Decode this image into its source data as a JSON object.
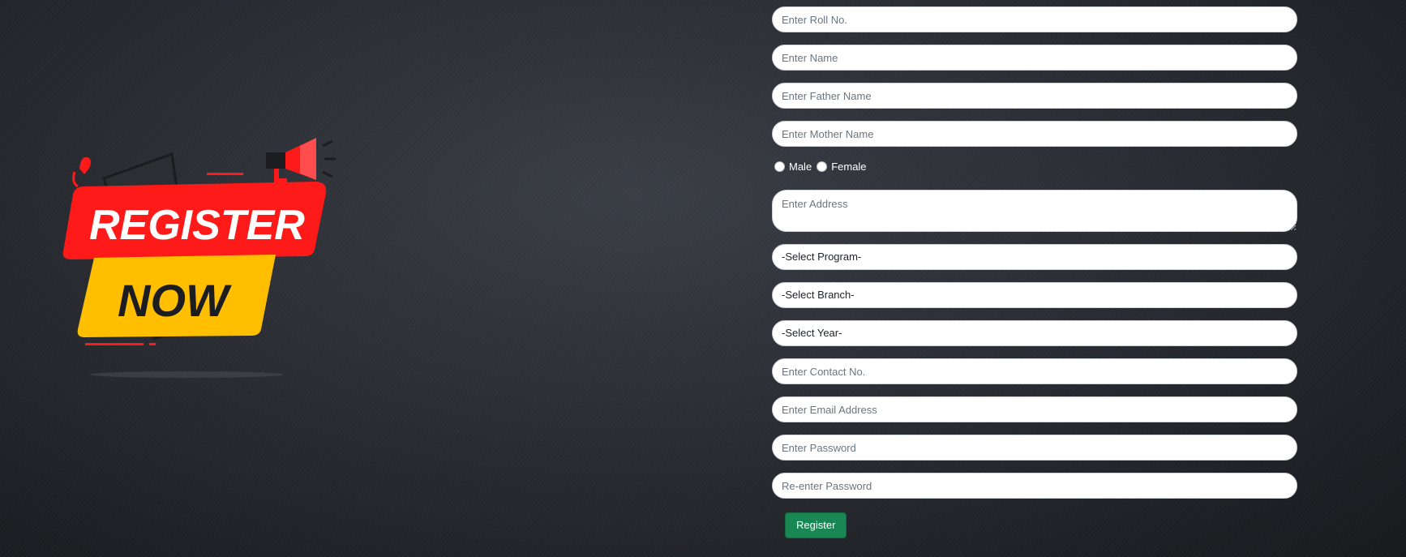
{
  "banner": {
    "line1": "REGISTER",
    "line2": "NOW"
  },
  "form": {
    "roll_placeholder": "Enter Roll No.",
    "name_placeholder": "Enter Name",
    "father_placeholder": "Enter Father Name",
    "mother_placeholder": "Enter Mother Name",
    "gender": {
      "male_label": "Male",
      "female_label": "Female"
    },
    "address_placeholder": "Enter Address",
    "program_selected": "-Select Program-",
    "branch_selected": "-Select Branch-",
    "year_selected": "-Select Year-",
    "contact_placeholder": "Enter Contact No.",
    "email_placeholder": "Enter Email Address",
    "password_placeholder": "Enter Password",
    "repassword_placeholder": "Re-enter Password",
    "submit_label": "Register"
  },
  "colors": {
    "banner_red": "#ff1a1a",
    "banner_yellow": "#ffbf00",
    "submit_green": "#198754"
  }
}
